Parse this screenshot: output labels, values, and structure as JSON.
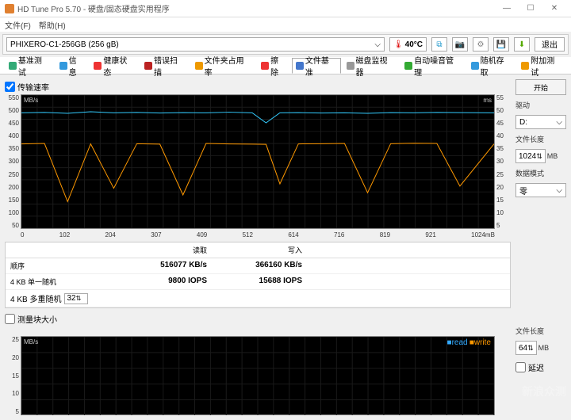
{
  "window": {
    "title": "HD Tune Pro 5.70 - 硬盘/固态硬盘实用程序"
  },
  "menu": [
    "文件(F)",
    "帮助(H)"
  ],
  "drive": "PHIXERO-C1-256GB (256 gB)",
  "temperature": "40°C",
  "exit_label": "退出",
  "tabs": [
    {
      "icon": "#3a7",
      "label": "基准测试"
    },
    {
      "icon": "#39d",
      "label": "信息"
    },
    {
      "icon": "#e33",
      "label": "健康状态"
    },
    {
      "icon": "#b22",
      "label": "错误扫描"
    },
    {
      "icon": "#e90",
      "label": "文件夹占用率"
    },
    {
      "icon": "#e33",
      "label": "擦除"
    },
    {
      "icon": "#47c",
      "label": "文件基准",
      "active": true
    },
    {
      "icon": "#999",
      "label": "磁盘监视器"
    },
    {
      "icon": "#3a3",
      "label": "自动噪音管理"
    },
    {
      "icon": "#39d",
      "label": "随机存取"
    },
    {
      "icon": "#e90",
      "label": "附加测试"
    }
  ],
  "section1_label": "传输速率",
  "y_unit": "MB/s",
  "r_unit": "ms",
  "y_ticks": [
    "550",
    "500",
    "450",
    "400",
    "350",
    "300",
    "250",
    "200",
    "150",
    "100",
    "50"
  ],
  "yr_ticks": [
    "55",
    "50",
    "45",
    "40",
    "35",
    "30",
    "25",
    "20",
    "15",
    "10",
    "5"
  ],
  "x_ticks": [
    "0",
    "102",
    "204",
    "307",
    "409",
    "512",
    "614",
    "716",
    "819",
    "921",
    "1024mB"
  ],
  "table": {
    "headers": [
      "",
      "读取",
      "写入"
    ],
    "rows": [
      {
        "label": "顺序",
        "read": "516077 KB/s",
        "write": "366160 KB/s"
      },
      {
        "label": "4 KB 单一随机",
        "read": "9800 IOPS",
        "write": "15688 IOPS"
      },
      {
        "label": "4 KB 多重随机",
        "spinner": "32",
        "read": "",
        "write": ""
      }
    ]
  },
  "section2_label": "测量块大小",
  "legend": {
    "read": "read",
    "write": "write"
  },
  "y2_ticks": [
    "25",
    "20",
    "15",
    "10",
    "5"
  ],
  "side": {
    "start": "开始",
    "drive_label": "驱动",
    "drive_value": "D:",
    "filelen_label": "文件长度",
    "filelen_value": "1024",
    "filelen_unit": "MB",
    "mode_label": "数据模式",
    "mode_value": "零",
    "side2_filelen": "文件长度",
    "side2_value": "64",
    "side2_unit": "MB",
    "side2_latency": "延迟"
  },
  "chart_data": {
    "type": "line",
    "title": "传输速率",
    "xlabel": "mB",
    "ylabel": "MB/s",
    "xlim": [
      0,
      1024
    ],
    "ylim": [
      0,
      600
    ],
    "x": [
      0,
      50,
      100,
      150,
      200,
      250,
      300,
      350,
      400,
      450,
      500,
      530,
      560,
      600,
      650,
      700,
      750,
      800,
      850,
      900,
      950,
      1024
    ],
    "series": [
      {
        "name": "read (MB/s)",
        "color": "#33ccff",
        "values": [
          520,
          522,
          518,
          525,
          520,
          522,
          519,
          521,
          520,
          523,
          520,
          475,
          520,
          521,
          519,
          520,
          518,
          521,
          520,
          522,
          521,
          520
        ]
      },
      {
        "name": "write (MB/s)",
        "color": "#ff9900",
        "values": [
          380,
          382,
          120,
          380,
          180,
          381,
          379,
          150,
          382,
          380,
          379,
          378,
          200,
          380,
          381,
          382,
          160,
          381,
          383,
          382,
          190,
          380
        ]
      }
    ]
  }
}
